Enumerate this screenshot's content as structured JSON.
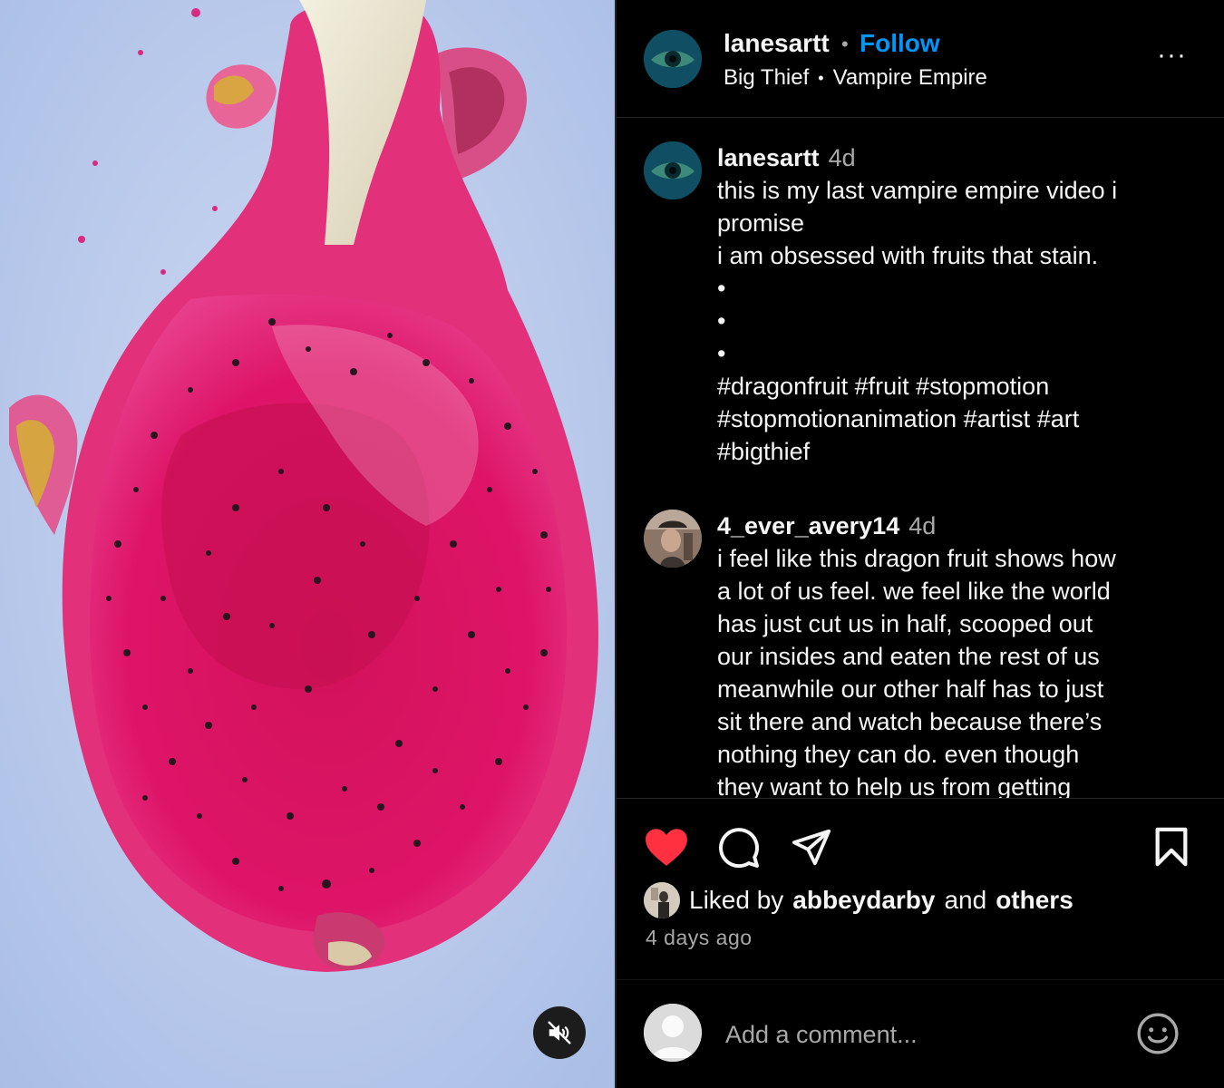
{
  "colors": {
    "accent": "#0095f6",
    "like": "#ff3040",
    "muted_text": "#a8a8a8"
  },
  "media": {
    "mute_icon": "speaker-muted-icon"
  },
  "header": {
    "username": "lanesartt",
    "separator": "•",
    "follow_label": "Follow",
    "artist": "Big Thief",
    "audio_separator": "•",
    "song": "Vampire Empire",
    "more_label": "···"
  },
  "caption": {
    "username": "lanesartt",
    "time": "4d",
    "lines": [
      "this is my last vampire empire video i",
      "promise",
      "i am obsessed with fruits that stain.",
      "•",
      "•",
      "•",
      "#dragonfruit #fruit #stopmotion",
      "#stopmotionanimation #artist #art",
      "#bigthief"
    ]
  },
  "comment1": {
    "username": "4_ever_avery14",
    "time": "4d",
    "lines": [
      "i feel like this dragon fruit shows how",
      "a lot of us feel. we feel like the world",
      "has just cut us in half, scooped out",
      "our insides and eaten the rest of us",
      "meanwhile our other half has to just",
      "sit there and watch because there’s",
      "nothing they can do. even though",
      "they want to help us from getting"
    ]
  },
  "actions": {
    "like_icon": "heart-filled-icon",
    "comment_icon": "comment-bubble-icon",
    "share_icon": "paper-plane-icon",
    "save_icon": "bookmark-icon"
  },
  "likes": {
    "prefix": "Liked by",
    "user": "abbeydarby",
    "conjunction": "and",
    "others": "others"
  },
  "posted": "4 days ago",
  "composer": {
    "placeholder": "Add a comment...",
    "emoji_icon": "smiley-icon"
  }
}
